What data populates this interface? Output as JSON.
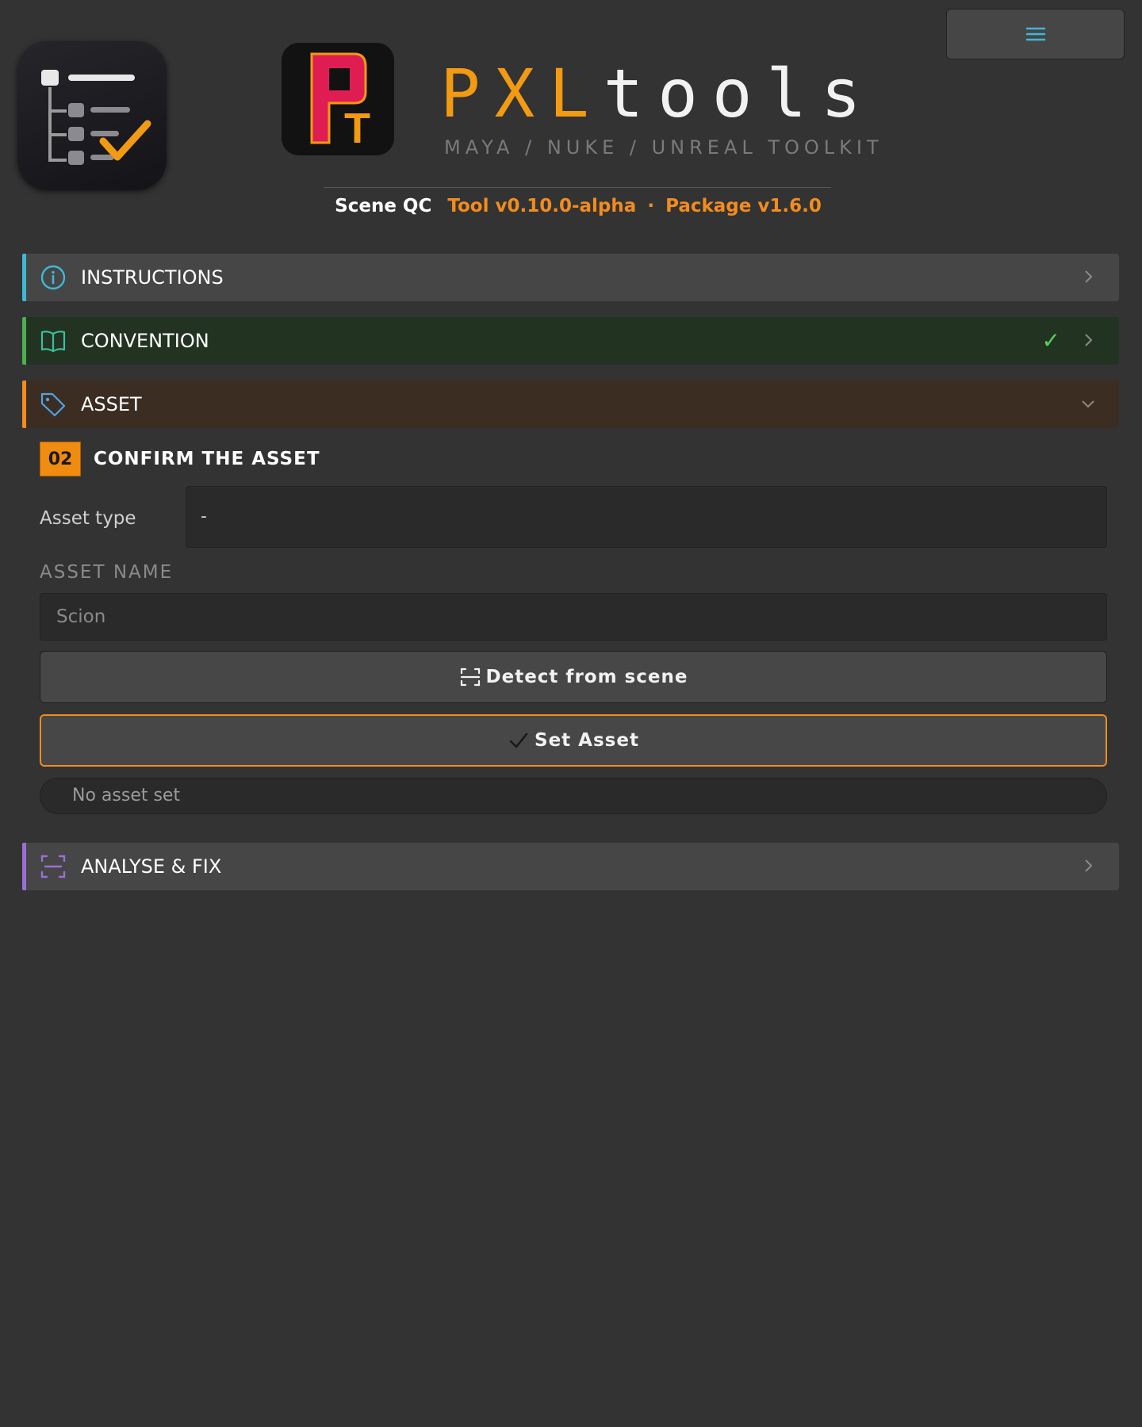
{
  "brand": {
    "badge_letters": [
      "P",
      "T"
    ],
    "title_pxl": "PXL",
    "title_tools": "tools",
    "subtitle": "MAYA / NUKE / UNREAL TOOLKIT"
  },
  "header": {
    "app_name": "Scene QC",
    "tool_version": "Tool v0.10.0-alpha",
    "separator": "·",
    "package_version": "Package v1.6.0",
    "menu_icon": "hamburger-menu-icon"
  },
  "sections": {
    "instructions": {
      "label": "INSTRUCTIONS",
      "icon": "info-circle-icon",
      "accent": "#3fb8d6",
      "state": "collapsed"
    },
    "convention": {
      "label": "CONVENTION",
      "icon": "book-icon",
      "accent": "#4caf50",
      "state": "collapsed",
      "status": "✓"
    },
    "asset": {
      "label": "ASSET",
      "icon": "tag-icon",
      "accent": "#f28c1e",
      "state": "expanded"
    },
    "analyse": {
      "label": "ANALYSE & FIX",
      "icon": "scan-icon",
      "accent": "#9b6fd6",
      "state": "collapsed"
    }
  },
  "asset_panel": {
    "step_number": "02",
    "step_title": "CONFIRM THE ASSET",
    "asset_type_label": "Asset type",
    "asset_type_value": "-",
    "asset_name_label": "ASSET NAME",
    "asset_name_placeholder": "Scion",
    "detect_button": "Detect from scene",
    "set_button": "Set Asset",
    "status": "No asset set"
  },
  "colors": {
    "background": "#333333",
    "accent_orange": "#f28c1e",
    "accent_cyan": "#3fb8d6",
    "accent_green": "#4caf50",
    "accent_purple": "#9b6fd6"
  }
}
